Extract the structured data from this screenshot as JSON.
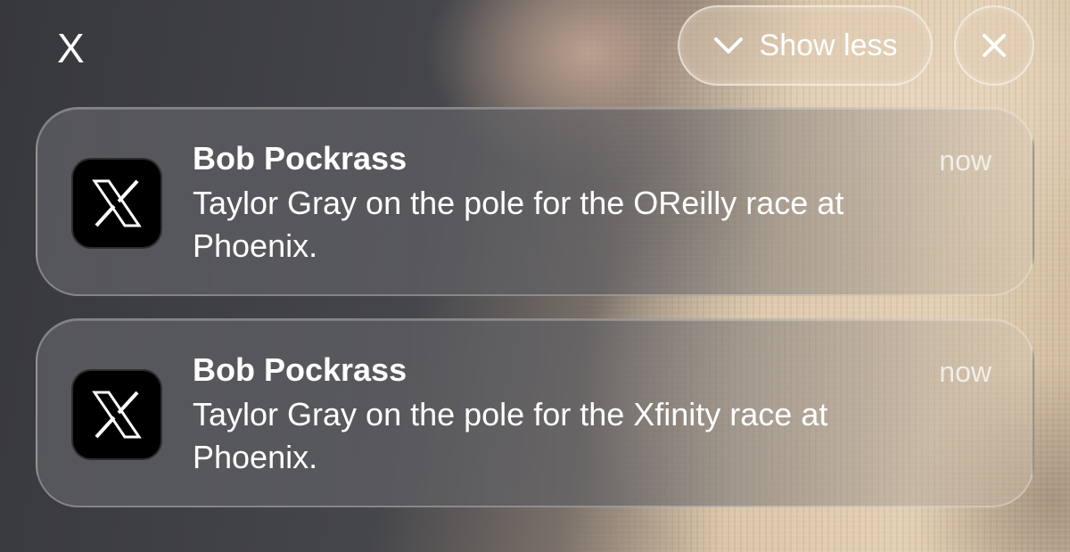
{
  "top_bar": {
    "app_label": "X",
    "show_less_label": "Show less",
    "show_less_icon": "chevron-down-icon",
    "close_icon": "close-icon"
  },
  "notifications": [
    {
      "app_icon": "x-logo-icon",
      "sender": "Bob Pockrass",
      "time": "now",
      "message": "Taylor Gray on the pole for the OReilly race at Phoenix."
    },
    {
      "app_icon": "x-logo-icon",
      "sender": "Bob Pockrass",
      "time": "now",
      "message": "Taylor Gray on the pole for the Xfinity race at Phoenix."
    }
  ],
  "colors": {
    "text": "#ffffff",
    "time_text": "#b8b8b8",
    "icon_bg": "#000000"
  }
}
